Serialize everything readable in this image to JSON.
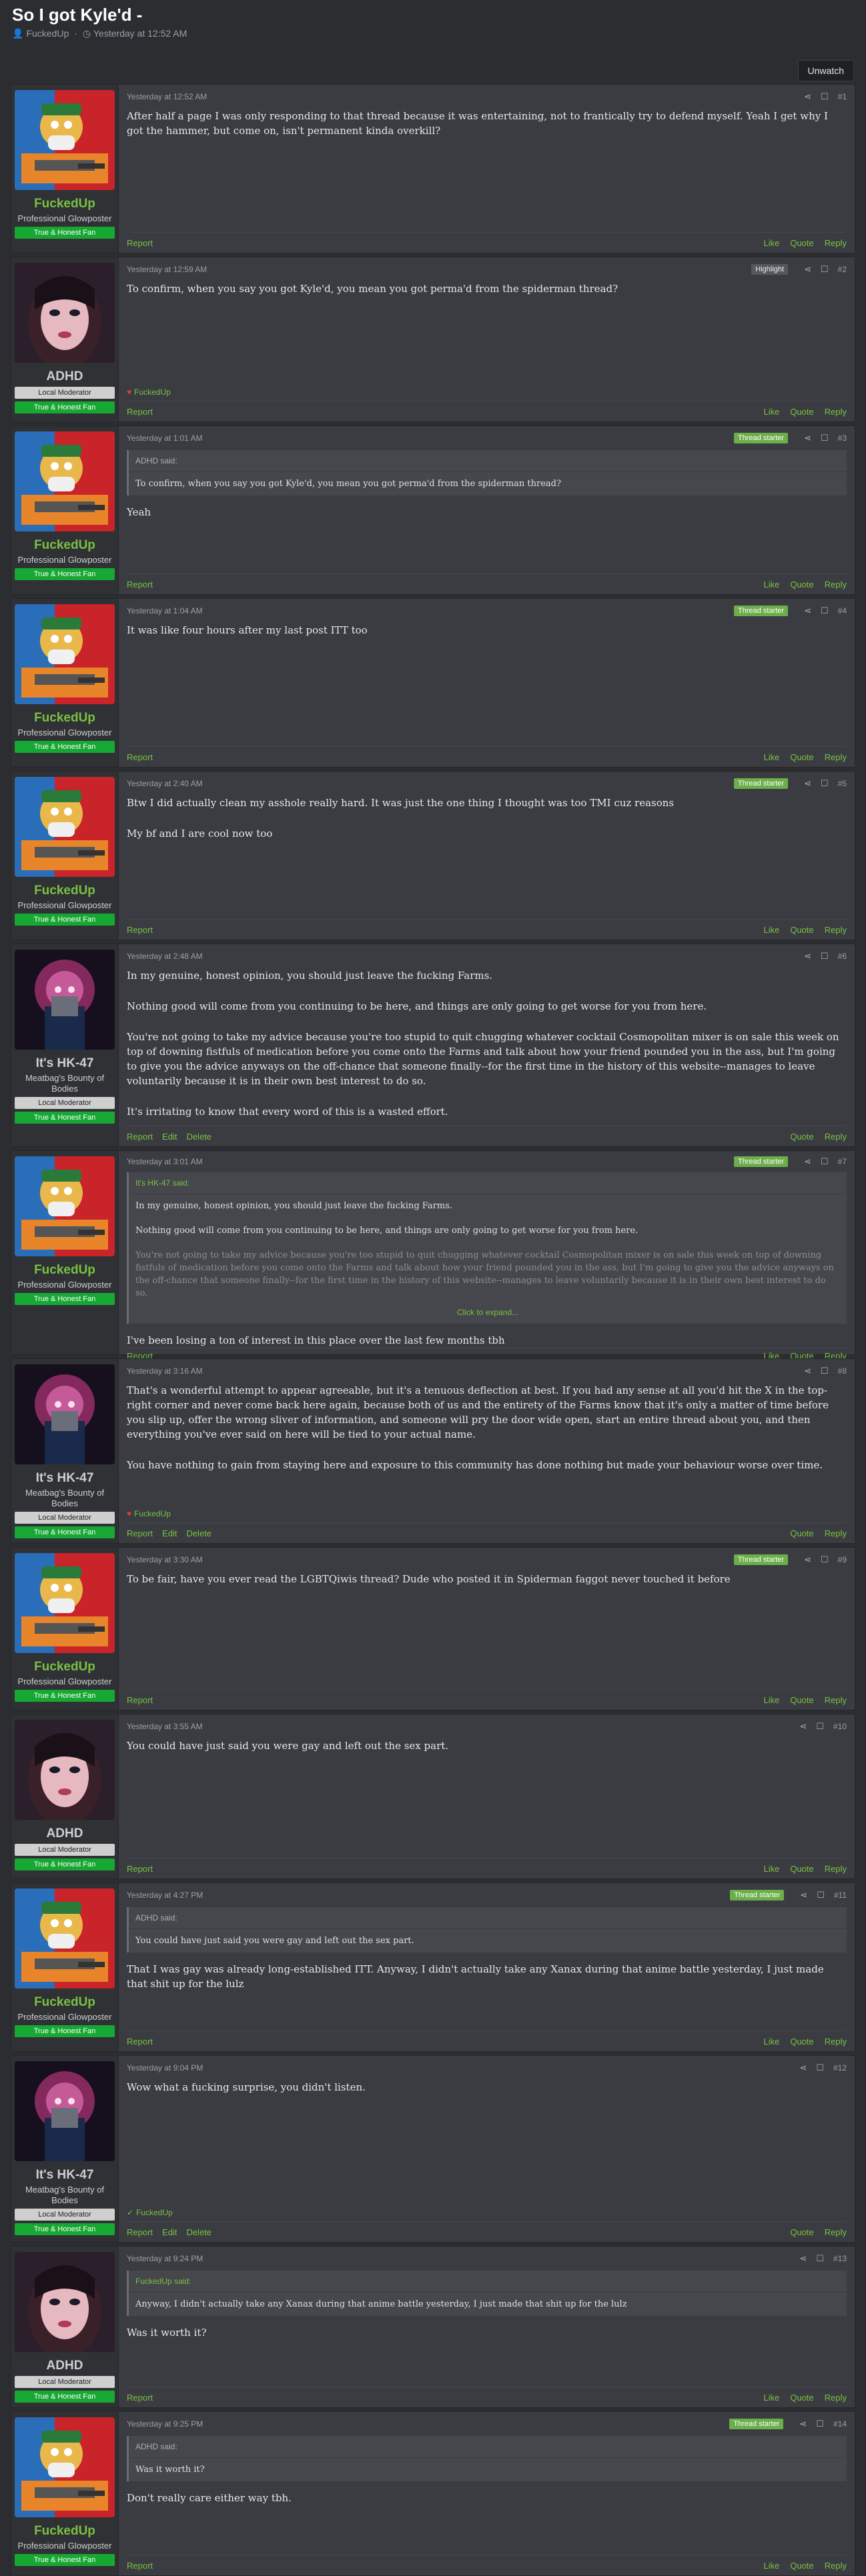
{
  "thread": {
    "title": "So I got Kyle'd -",
    "author": "FuckedUp",
    "date": "Yesterday at 12:52 AM"
  },
  "toolbar": {
    "watch_label": "Unwatch"
  },
  "labels": {
    "report": "Report",
    "like": "Like",
    "quote": "Quote",
    "reply": "Reply",
    "edit": "Edit",
    "delete": "Delete",
    "thread_starter": "Thread starter",
    "highlight": "Highlight",
    "click_expand": "Click to expand..."
  },
  "users": {
    "fuckedup": {
      "name": "FuckedUp",
      "title": "Professional Glowposter",
      "badge": "True & Honest Fan"
    },
    "adhd": {
      "name": "ADHD",
      "mod": "Local Moderator",
      "badge": "True & Honest Fan"
    },
    "hk47": {
      "name": "It's HK-47",
      "title": "Meatbag's Bounty of Bodies",
      "mod": "Local Moderator",
      "badge": "True & Honest Fan"
    }
  },
  "posts": [
    {
      "num": "#1",
      "date": "Yesterday at 12:52 AM",
      "body": [
        "After half a page I was only responding to that thread because it was entertaining, not to frantically try to defend myself. Yeah I get why I got the hammer, but come on, isn't permanent kinda overkill?"
      ]
    },
    {
      "num": "#2",
      "date": "Yesterday at 12:59 AM",
      "body": [
        "To confirm, when you say you got Kyle'd, you mean you got perma'd from the spiderman thread?"
      ],
      "reaction": "FuckedUp"
    },
    {
      "num": "#3",
      "date": "Yesterday at 1:01 AM",
      "quote_author": "ADHD said:",
      "quote": [
        "To confirm, when you say you got Kyle'd, you mean you got perma'd from the spiderman thread?"
      ],
      "body": [
        "Yeah"
      ]
    },
    {
      "num": "#4",
      "date": "Yesterday at 1:04 AM",
      "body": [
        "It was like four hours after my last post ITT too"
      ]
    },
    {
      "num": "#5",
      "date": "Yesterday at 2:40 AM",
      "body": [
        "Btw I did actually clean my asshole really hard. It was just the one thing I thought was too TMI cuz reasons",
        "My bf and I are cool now too"
      ]
    },
    {
      "num": "#6",
      "date": "Yesterday at 2:48 AM",
      "body": [
        "In my genuine, honest opinion, you should just leave the fucking Farms.",
        "Nothing good will come from you continuing to be here, and things are only going to get worse for you from here.",
        "You're not going to take my advice because you're too stupid to quit chugging whatever cocktail Cosmopolitan mixer is on sale this week on top of downing fistfuls of medication before you come onto the Farms and talk about how your friend pounded you in the ass, but I'm going to give you the advice anyways on the off-chance that someone finally--for the first time in the history of this website--manages to leave voluntarily because it is in their own best interest to do so.",
        "It's irritating to know that every word of this is a wasted effort."
      ]
    },
    {
      "num": "#7",
      "date": "Yesterday at 3:01 AM",
      "quote_author": "It's HK-47 said:",
      "quote": [
        "In my genuine, honest opinion, you should just leave the fucking Farms.",
        "Nothing good will come from you continuing to be here, and things are only going to get worse for you from here.",
        "You're not going to take my advice because you're too stupid to quit chugging whatever cocktail Cosmopolitan mixer is on sale this week on top of downing fistfuls of medication before you come onto the Farms and talk about how your friend pounded you in the ass, but I'm going to give you the advice anyways on the off-chance that someone finally--for the first time in the history of this website--manages to leave voluntarily because it is in their own best interest to do so."
      ],
      "body": [
        "I've been losing a ton of interest in this place over the last few months tbh"
      ]
    },
    {
      "num": "#8",
      "date": "Yesterday at 3:16 AM",
      "body": [
        "That's a wonderful attempt to appear agreeable, but it's a tenuous deflection at best. If you had any sense at all you'd hit the X in the top-right corner and never come back here again, because both of us and the entirety of the Farms know that it's only a matter of time before you slip up, offer the wrong sliver of information, and someone will pry the door wide open, start an entire thread about you, and then everything you've ever said on here will be tied to your actual name.",
        "You have nothing to gain from staying here and exposure to this community has done nothing but made your behaviour worse over time."
      ],
      "reaction": "FuckedUp"
    },
    {
      "num": "#9",
      "date": "Yesterday at 3:30 AM",
      "body": [
        "To be fair, have you ever read the LGBTQiwis thread? Dude who posted it in Spiderman faggot never touched it before"
      ]
    },
    {
      "num": "#10",
      "date": "Yesterday at 3:55 AM",
      "body": [
        "You could have just said you were gay and left out the sex part."
      ]
    },
    {
      "num": "#11",
      "date": "Yesterday at 4:27 PM",
      "quote_author": "ADHD said:",
      "quote": [
        "You could have just said you were gay and left out the sex part."
      ],
      "body": [
        "That I was gay was already long-established ITT. Anyway, I didn't actually take any Xanax during that anime battle yesterday, I just made that shit up for the lulz"
      ]
    },
    {
      "num": "#12",
      "date": "Yesterday at 9:04 PM",
      "body": [
        "Wow what a fucking surprise, you didn't listen."
      ],
      "reaction": "FuckedUp"
    },
    {
      "num": "#13",
      "date": "Yesterday at 9:24 PM",
      "quote_author": "FuckedUp said:",
      "quote": [
        "Anyway, I didn't actually take any Xanax during that anime battle yesterday, I just made that shit up for the lulz"
      ],
      "body": [
        "Was it worth it?"
      ]
    },
    {
      "num": "#14",
      "date": "Yesterday at 9:25 PM",
      "quote_author": "ADHD said:",
      "quote": [
        "Was it worth it?"
      ],
      "body": [
        "Don't really care either way tbh."
      ]
    }
  ]
}
